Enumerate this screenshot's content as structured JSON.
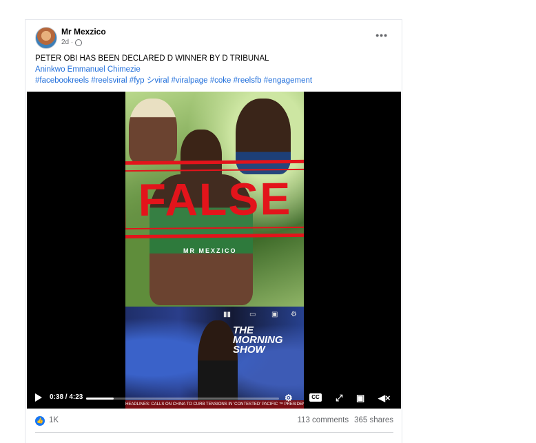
{
  "post": {
    "author": "Mr Mexzico",
    "time": "2d ·",
    "more_label": "•••",
    "caption_line": "PETER OBI HAS BEEN DECLARED D WINNER BY D TRIBUNAL",
    "tagged_name": "Aninkwo Emmanuel Chimezie",
    "hashtags": "#facebookreels #reelsviral #fyp シviral #viralpage #coke #reelsfb #engagement"
  },
  "video": {
    "overlay_stamp": "FALSE",
    "watermark": "MR MEXZICO",
    "show_title": "THE MORNING SHOW",
    "ticker_text": "HEADLINES: CALLS ON CHINA TO CURB TENSIONS IN 'CONTESTED' PACIFIC  ™  PRESIDENT BOLA",
    "time_display": "0:38 / 4:23",
    "progress_fraction": 0.144,
    "cc_label": "CC"
  },
  "footer": {
    "like_count": "1K",
    "comments": "113 comments",
    "shares": "365 shares"
  },
  "colors": {
    "stamp_red": "#e3141b",
    "link_blue": "#216fdb",
    "like_blue": "#1877f2"
  },
  "icons": [
    "globe-icon",
    "more-options-icon",
    "play-icon",
    "settings-icon",
    "cc-icon",
    "fullscreen-icon",
    "picture-in-picture-icon",
    "mute-icon",
    "like-icon"
  ]
}
